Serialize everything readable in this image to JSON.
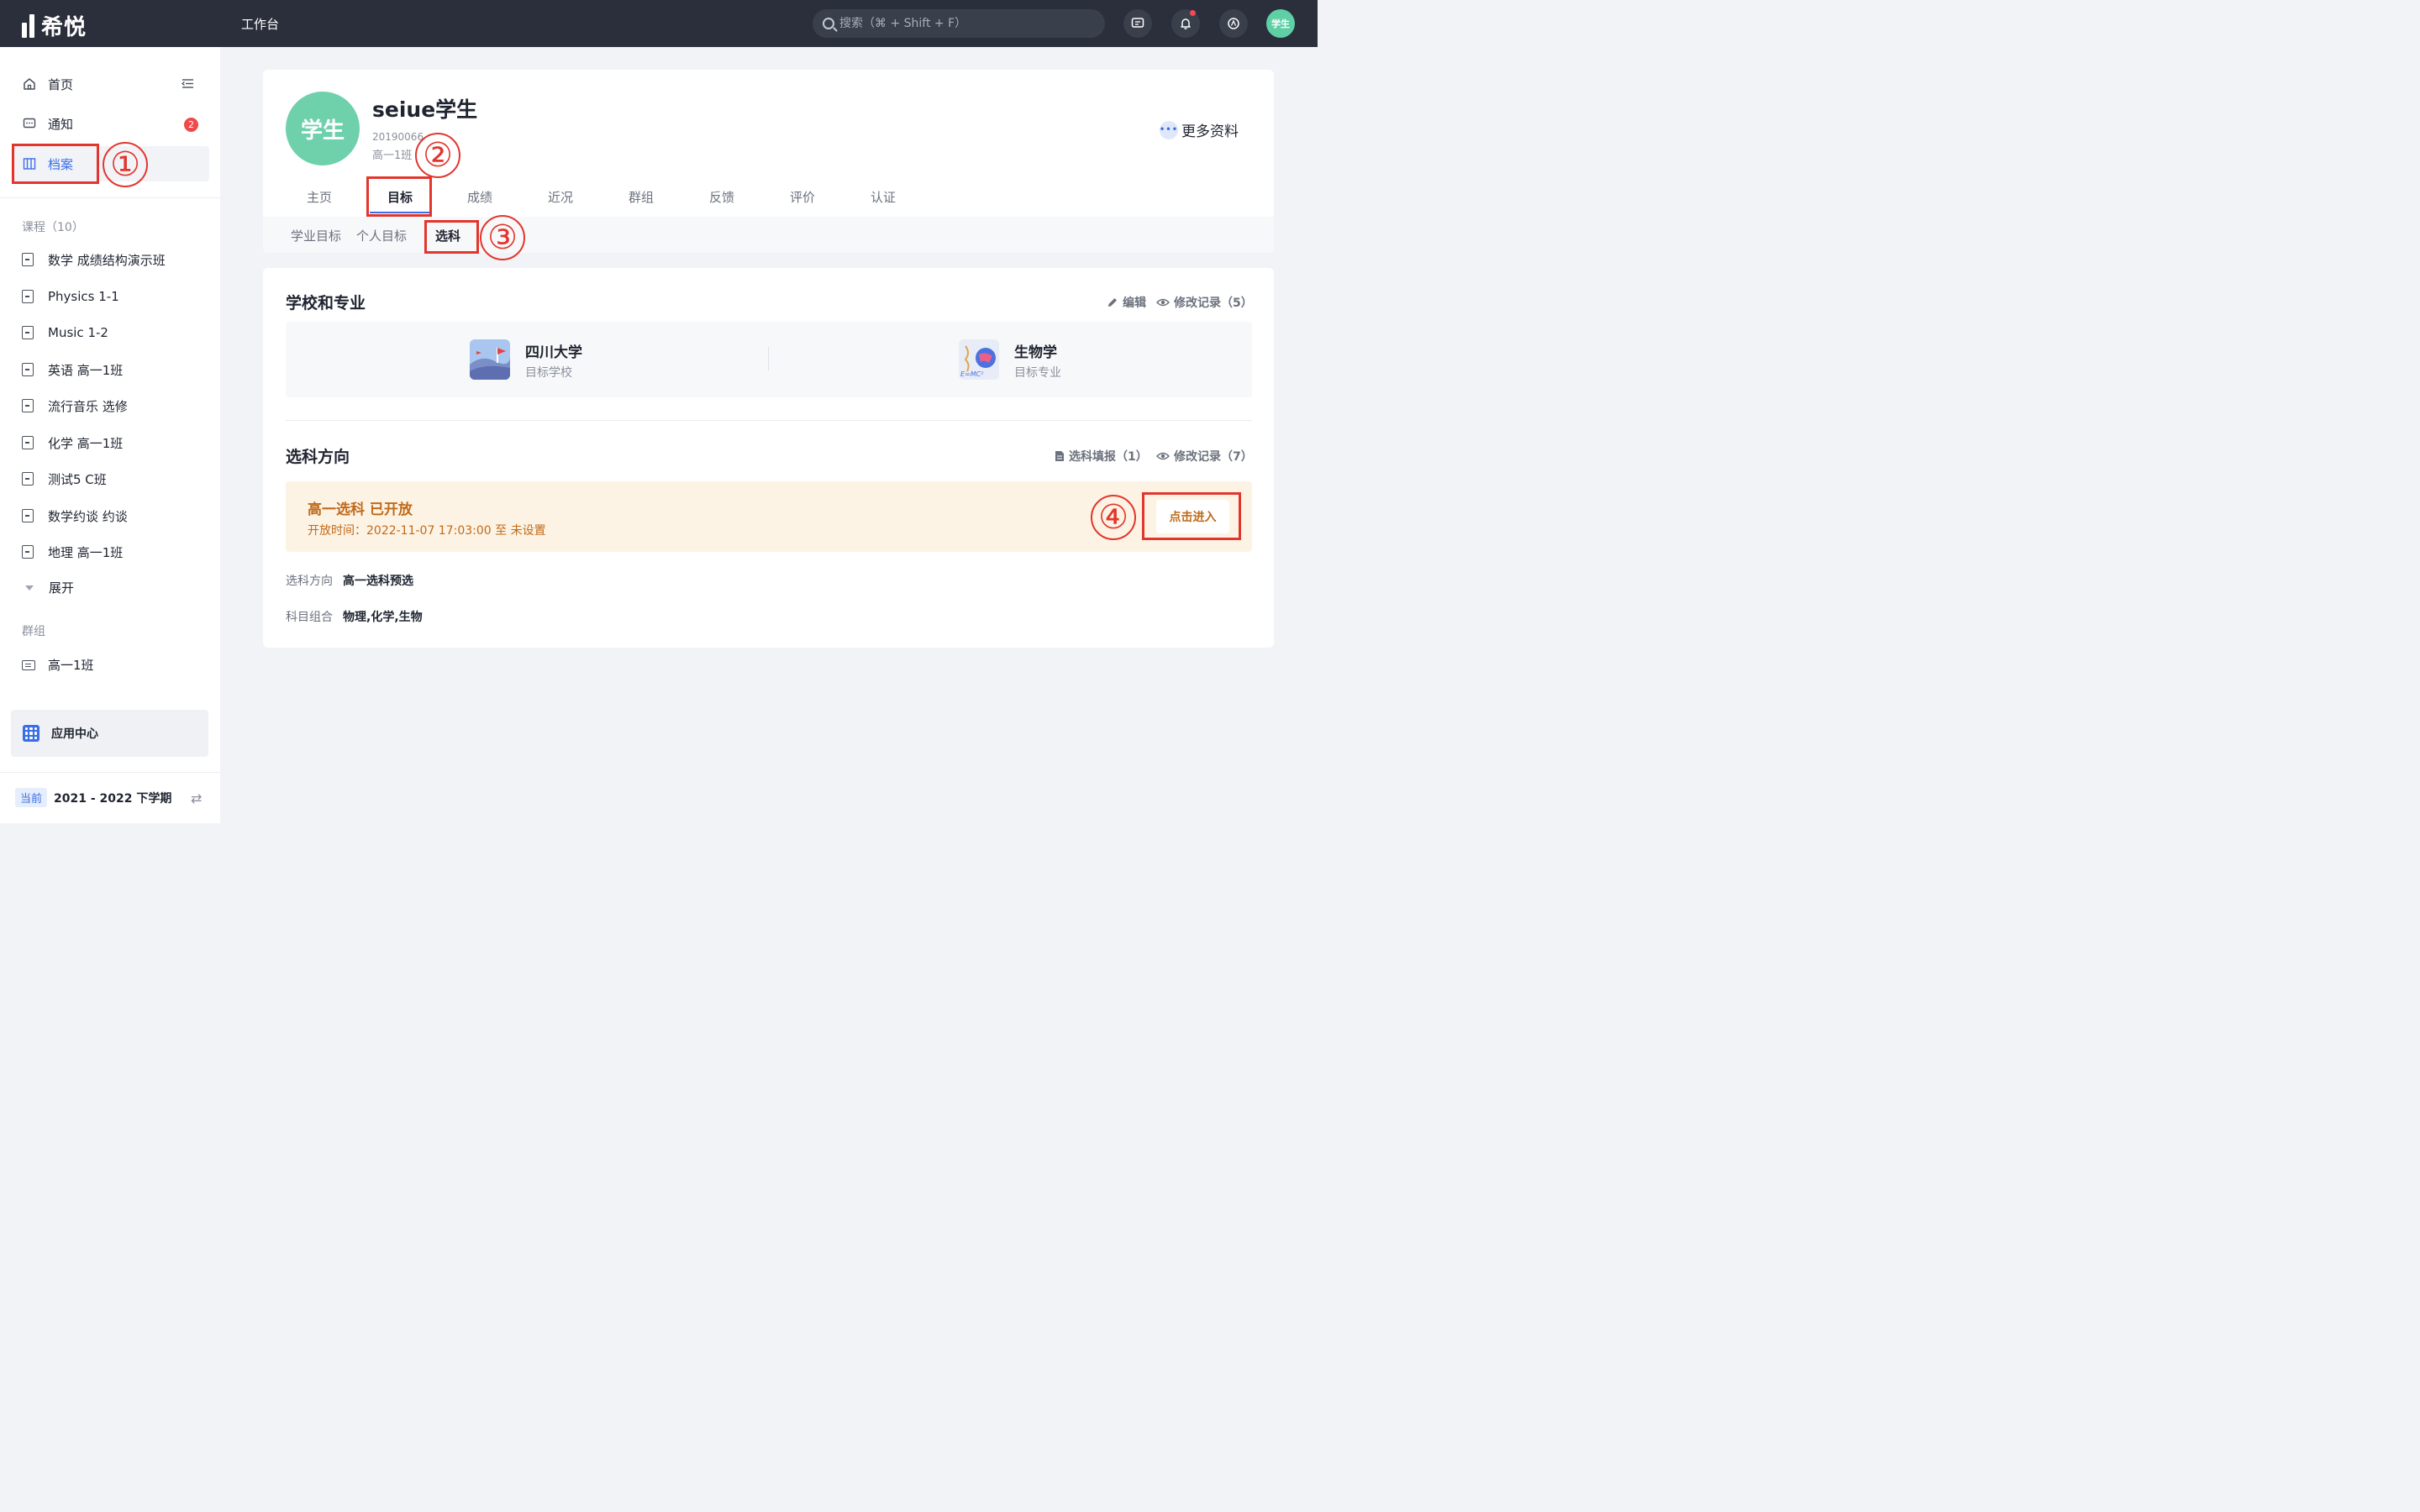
{
  "topbar": {
    "logo_text": "希悦",
    "workbench": "工作台",
    "search_placeholder": "搜索（⌘ + Shift + F）",
    "avatar_text": "学生"
  },
  "sidebar": {
    "nav": [
      {
        "label": "首页",
        "icon": "home-icon"
      },
      {
        "label": "通知",
        "icon": "message-icon",
        "badge": "2"
      },
      {
        "label": "档案",
        "icon": "archive-icon",
        "active": true
      }
    ],
    "courses_title": "课程（10）",
    "courses": [
      "数学 成绩结构演示班",
      "Physics 1-1",
      "Music 1-2",
      "英语 高一1班",
      "流行音乐 选修",
      "化学 高一1班",
      "测试5 C班",
      "数学约谈 约谈",
      "地理 高一1班"
    ],
    "expand_label": "展开",
    "groups_title": "群组",
    "groups": [
      "高一1班"
    ],
    "app_center": "应用中心",
    "term_current": "当前",
    "term_label": "2021 - 2022 下学期"
  },
  "annotations": [
    "①",
    "②",
    "③",
    "④"
  ],
  "profile": {
    "avatar_text": "学生",
    "name": "seiue学生",
    "student_id": "20190066",
    "class": "高一1班",
    "more_label": "更多资料",
    "tabs": [
      "主页",
      "目标",
      "成绩",
      "近况",
      "群组",
      "反馈",
      "评价",
      "认证"
    ],
    "active_tab": "目标",
    "subtabs": [
      "学业目标",
      "个人目标",
      "选科"
    ],
    "active_subtab": "选科"
  },
  "school_section": {
    "title": "学校和专业",
    "edit_label": "编辑",
    "history_label": "修改记录（5）",
    "school_name": "四川大学",
    "school_label": "目标学校",
    "major_name": "生物学",
    "major_label": "目标专业"
  },
  "selection_section": {
    "title": "选科方向",
    "report_label": "选科填报（1）",
    "history_label": "修改记录（7）",
    "notice_title": "高一选科 已开放",
    "notice_time": "开放时间：2022-11-07 17:03:00 至 未设置",
    "enter_label": "点击进入",
    "direction_key": "选科方向",
    "direction_value": "高一选科预选",
    "combo_key": "科目组合",
    "combo_value": "物理,化学,生物"
  },
  "colors": {
    "topbar": "#2b2f3b",
    "accent": "#3a6ee8",
    "annotation_red": "#e2362d",
    "notice_bg": "#fdf3e4",
    "notice_text": "#c06a1a",
    "avatar_green": "#6fd1ac"
  }
}
